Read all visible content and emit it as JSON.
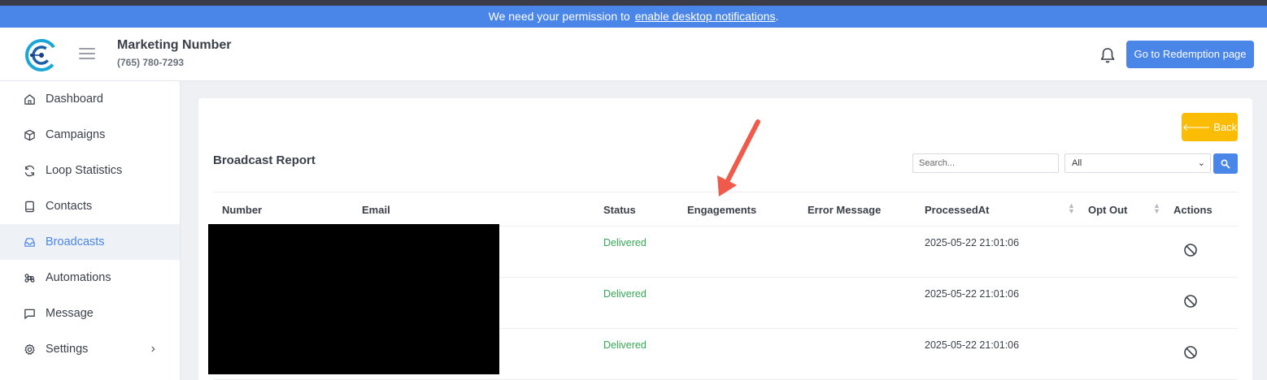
{
  "notice": {
    "text": "We need your permission to",
    "link": "enable desktop notifications",
    "suffix": "."
  },
  "header": {
    "account_name": "Marketing Number",
    "account_phone": "(765) 780-7293",
    "redeem_button": "Go to Redemption page"
  },
  "sidebar": {
    "items": [
      {
        "label": "Dashboard",
        "icon": "home-icon"
      },
      {
        "label": "Campaigns",
        "icon": "cube-icon"
      },
      {
        "label": "Loop Statistics",
        "icon": "refresh-icon"
      },
      {
        "label": "Contacts",
        "icon": "phone-book-icon"
      },
      {
        "label": "Broadcasts",
        "icon": "inbox-icon",
        "active": true
      },
      {
        "label": "Automations",
        "icon": "command-icon"
      },
      {
        "label": "Message",
        "icon": "chat-icon"
      },
      {
        "label": "Settings",
        "icon": "gear-icon"
      }
    ]
  },
  "report": {
    "back_label": "🡐 Back",
    "title": "Broadcast Report",
    "search_placeholder": "Search...",
    "filter_value": "All",
    "columns": [
      "Number",
      "Email",
      "Status",
      "Engagements",
      "Error Message",
      "ProcessedAt",
      "Opt Out",
      "Actions"
    ],
    "rows": [
      {
        "status": "Delivered",
        "processed_at": "2025-05-22 21:01:06"
      },
      {
        "status": "Delivered",
        "processed_at": "2025-05-22 21:01:06"
      },
      {
        "status": "Delivered",
        "processed_at": "2025-05-22 21:01:06"
      }
    ]
  },
  "colors": {
    "primary": "#4a86e8",
    "warning": "#fbbc05",
    "success": "#34a853",
    "annotation": "#f05a4a"
  }
}
